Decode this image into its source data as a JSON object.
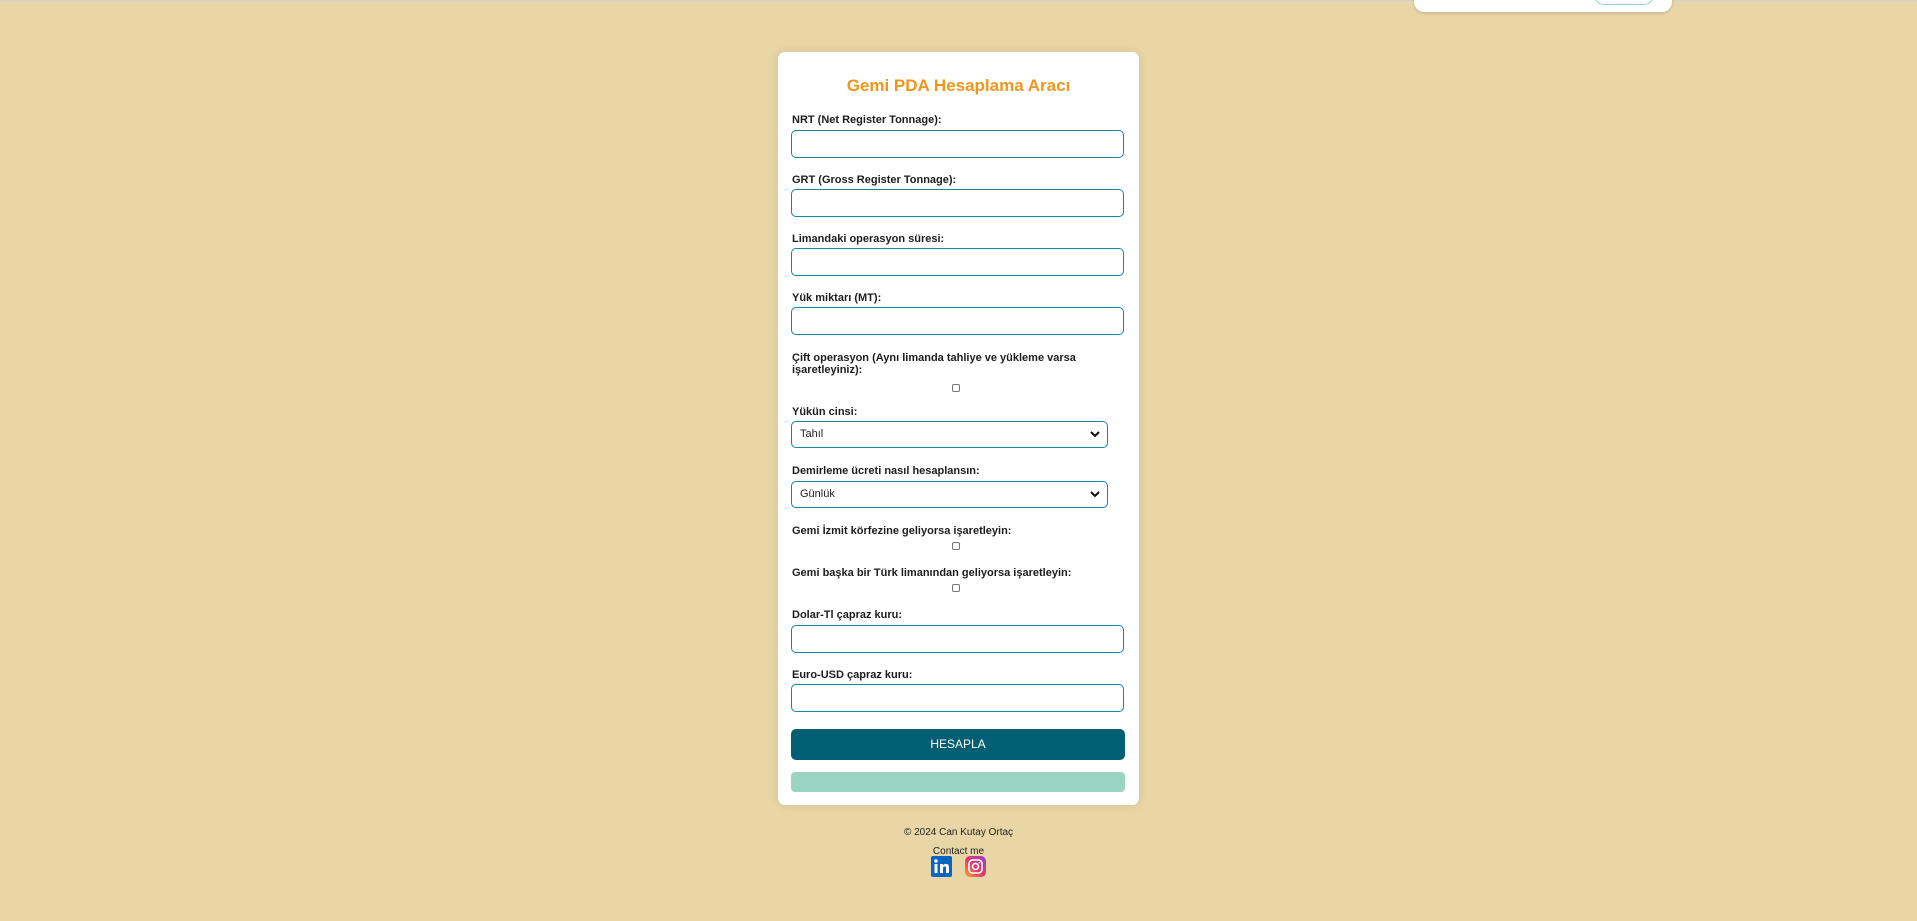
{
  "app": {
    "title": "Gemi PDA Hesaplama Aracı"
  },
  "form": {
    "nrt_label": "NRT (Net Register Tonnage):",
    "nrt_value": "",
    "grt_label": "GRT (Gross Register Tonnage):",
    "grt_value": "",
    "operation_duration_label": "Limandaki operasyon süresi:",
    "operation_duration_value": "",
    "cargo_amount_label": "Yük miktarı (MT):",
    "cargo_amount_value": "",
    "double_operation_label": "Çift operasyon (Aynı limanda tahliye ve yükleme varsa işaretleyiniz):",
    "double_operation_checked": false,
    "cargo_type_label": "Yükün cinsi:",
    "cargo_type_selected": "Tahıl",
    "mooring_fee_label": "Demirleme ücreti nasıl hesaplansın:",
    "mooring_fee_selected": "Günlük",
    "izmit_label": "Gemi İzmit körfezine geliyorsa işaretleyin:",
    "izmit_checked": false,
    "turkish_port_label": "Gemi başka bir Türk limanından geliyorsa işaretleyin:",
    "turkish_port_checked": false,
    "usd_try_label": "Dolar-Tl çapraz kuru:",
    "usd_try_value": "",
    "eur_usd_label": "Euro-USD çapraz kuru:",
    "eur_usd_value": "",
    "submit_label": "HESAPLA",
    "result_text": ""
  },
  "footer": {
    "copyright": "© 2024 Can Kutay Ortaç",
    "contact": "Contact me",
    "icons": [
      "linkedin-icon",
      "instagram-icon"
    ]
  },
  "colors": {
    "background": "#e8d6a6",
    "title": "#f0961a",
    "accent": "#0f8a96",
    "button": "#025e72",
    "result": "#99d5c2"
  }
}
